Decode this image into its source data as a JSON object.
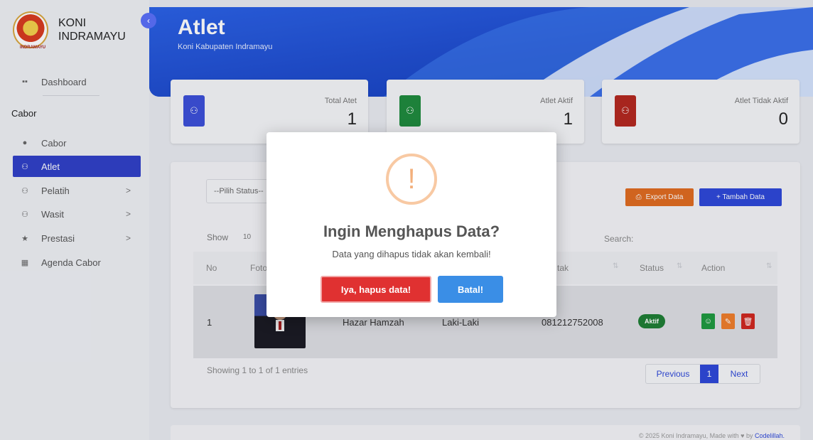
{
  "brand": {
    "logo_text": "INDRAMAYU",
    "title": "KONI\nINDRAMAYU"
  },
  "sidebar": {
    "collapse_icon": "chevron-left-icon",
    "dashboard": "Dashboard",
    "section": "Cabor",
    "items": [
      {
        "label": "Cabor",
        "icon": "cabor-icon"
      },
      {
        "label": "Atlet",
        "icon": "users-icon",
        "active": true
      },
      {
        "label": "Pelatih",
        "icon": "users-icon",
        "chevron": ">"
      },
      {
        "label": "Wasit",
        "icon": "users-icon",
        "chevron": ">"
      },
      {
        "label": "Prestasi",
        "icon": "star-icon",
        "chevron": ">"
      },
      {
        "label": "Agenda Cabor",
        "icon": "calendar-icon"
      }
    ]
  },
  "header": {
    "title": "Atlet",
    "subtitle": "Koni Kabupaten Indramayu"
  },
  "stats": [
    {
      "label": "Total Atet",
      "value": "1",
      "color": "#3b4fd8"
    },
    {
      "label": "Atlet Aktif",
      "value": "1",
      "color": "#1e8a3c"
    },
    {
      "label": "Atlet Tidak Aktif",
      "value": "0",
      "color": "#b3261e"
    }
  ],
  "toolbar": {
    "status_placeholder": "--Pilih Status--",
    "export_label": "Export Data",
    "add_label": "+  Tambah Data",
    "show_label": "Show",
    "show_value": "10",
    "search_label": "Search:"
  },
  "table": {
    "headers": {
      "no": "No",
      "foto": "Foto",
      "kontak": "tak",
      "status": "Status",
      "action": "Action"
    },
    "rows": [
      {
        "no": "1",
        "nama": "Hazar Hamzah",
        "jk": "Laki-Laki",
        "kontak": "081212752008",
        "status": "Aktif"
      }
    ]
  },
  "pagination": {
    "showing": "Showing 1 to 1 of 1 entries",
    "previous": "Previous",
    "page": "1",
    "next": "Next"
  },
  "footer": {
    "text": "© 2025 Koni Indramayu, Made with ♥ by",
    "link": "Codelillah."
  },
  "modal": {
    "icon": "!",
    "title": "Ingin Menghapus Data?",
    "text": "Data yang dihapus tidak akan kembali!",
    "confirm": "Iya, hapus data!",
    "cancel": "Batal!"
  }
}
